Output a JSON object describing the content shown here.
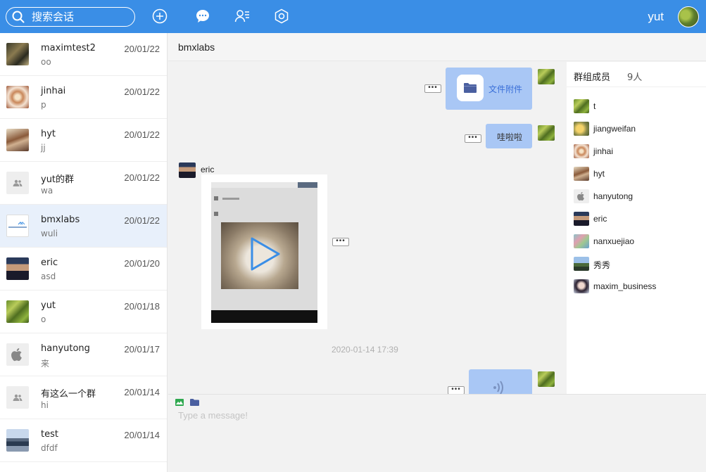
{
  "header": {
    "search_placeholder": "搜索会话",
    "username": "yut",
    "icons": [
      "search-icon",
      "add-circle-icon",
      "chat-bubble-icon",
      "contacts-icon",
      "settings-hex-icon"
    ]
  },
  "conversations": [
    {
      "name": "maximtest2",
      "preview": "oo",
      "date": "20/01/22"
    },
    {
      "name": "jinhai",
      "preview": "p",
      "date": "20/01/22"
    },
    {
      "name": "hyt",
      "preview": "jj",
      "date": "20/01/22"
    },
    {
      "name": "yut的群",
      "preview": "wa",
      "date": "20/01/22"
    },
    {
      "name": "bmxlabs",
      "preview": "wuli",
      "date": "20/01/22"
    },
    {
      "name": "eric",
      "preview": "asd",
      "date": "20/01/20"
    },
    {
      "name": "yut",
      "preview": "o",
      "date": "20/01/18"
    },
    {
      "name": "hanyutong",
      "preview": "来",
      "date": "20/01/17"
    },
    {
      "name": "有这么一个群",
      "preview": "hi",
      "date": "20/01/14"
    },
    {
      "name": "test",
      "preview": "dfdf",
      "date": "20/01/14"
    }
  ],
  "chat": {
    "title": "bmxlabs",
    "messages": {
      "file_label": "文件附件",
      "text_message": "哇啦啦",
      "sender_name": "eric",
      "timestamp": "2020-01-14 17:39",
      "more_label": "•••"
    },
    "input_placeholder": "Type a message!"
  },
  "members": {
    "title": "群组成员",
    "count": "9人",
    "list": [
      {
        "name": "t"
      },
      {
        "name": "jiangweifan"
      },
      {
        "name": "jinhai"
      },
      {
        "name": "hyt"
      },
      {
        "name": "hanyutong"
      },
      {
        "name": "eric"
      },
      {
        "name": "nanxuejiao"
      },
      {
        "name": "秀秀"
      },
      {
        "name": "maxim_business"
      }
    ]
  },
  "colors": {
    "topbar": "#3a8ee6",
    "bubble": "#a9c7f5",
    "active_row": "#e8f0fb"
  }
}
